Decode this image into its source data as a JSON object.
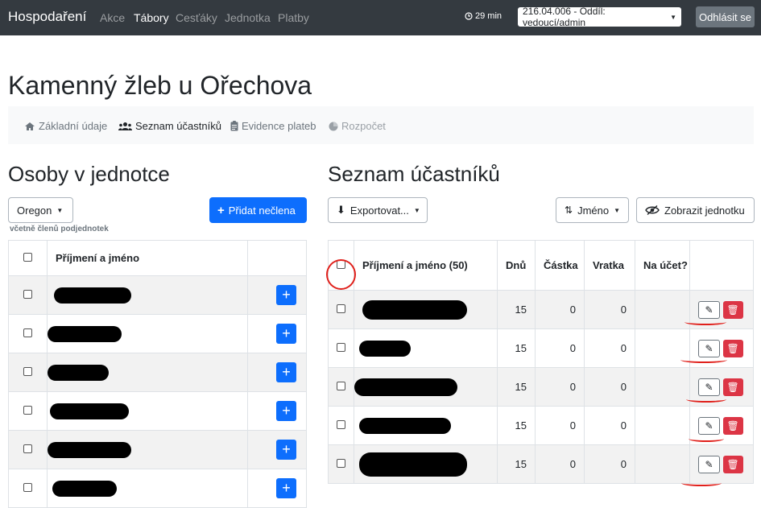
{
  "navbar": {
    "brand": "Hospodaření",
    "links": [
      "Akce",
      "Tábory",
      "Cesťáky",
      "Jednotka",
      "Platby"
    ],
    "active_link": "Tábory",
    "timer": "29 min",
    "role": "216.04.006 - Oddíl: vedoucí/admin",
    "logout": "Odhlásit se"
  },
  "page": {
    "title": "Kamenný žleb u Ořechova"
  },
  "tabs": [
    {
      "label": "Základní údaje",
      "icon": "home-icon",
      "state": "normal"
    },
    {
      "label": "Seznam účastníků",
      "icon": "users-icon",
      "state": "active"
    },
    {
      "label": "Evidence plateb",
      "icon": "clipboard-icon",
      "state": "normal"
    },
    {
      "label": "Rozpočet",
      "icon": "pie-chart-icon",
      "state": "disabled"
    }
  ],
  "left": {
    "heading": "Osoby v jednotce",
    "unit_dropdown": "Oregon",
    "add_button": "Přidat nečlena",
    "note": "včetně členů podjednotek",
    "column_name": "Příjmení a jméno",
    "row_count": 6
  },
  "right": {
    "heading": "Seznam účastníků",
    "export_button": "Exportovat...",
    "sort_button": "Jméno",
    "show_unit_button": "Zobrazit jednotku",
    "columns": [
      "Příjmení a jméno (50)",
      "Dnů",
      "Částka",
      "Vratka",
      "Na účet?"
    ],
    "rows": [
      {
        "days": "15",
        "amount": "0",
        "refund": "0"
      },
      {
        "days": "15",
        "amount": "0",
        "refund": "0"
      },
      {
        "days": "15",
        "amount": "0",
        "refund": "0"
      },
      {
        "days": "15",
        "amount": "0",
        "refund": "0"
      },
      {
        "days": "15",
        "amount": "0",
        "refund": "0"
      }
    ]
  },
  "colors": {
    "navbar": "#343a40",
    "primary": "#0d6efd",
    "danger": "#dc3545",
    "annotation": "#e0201b"
  }
}
